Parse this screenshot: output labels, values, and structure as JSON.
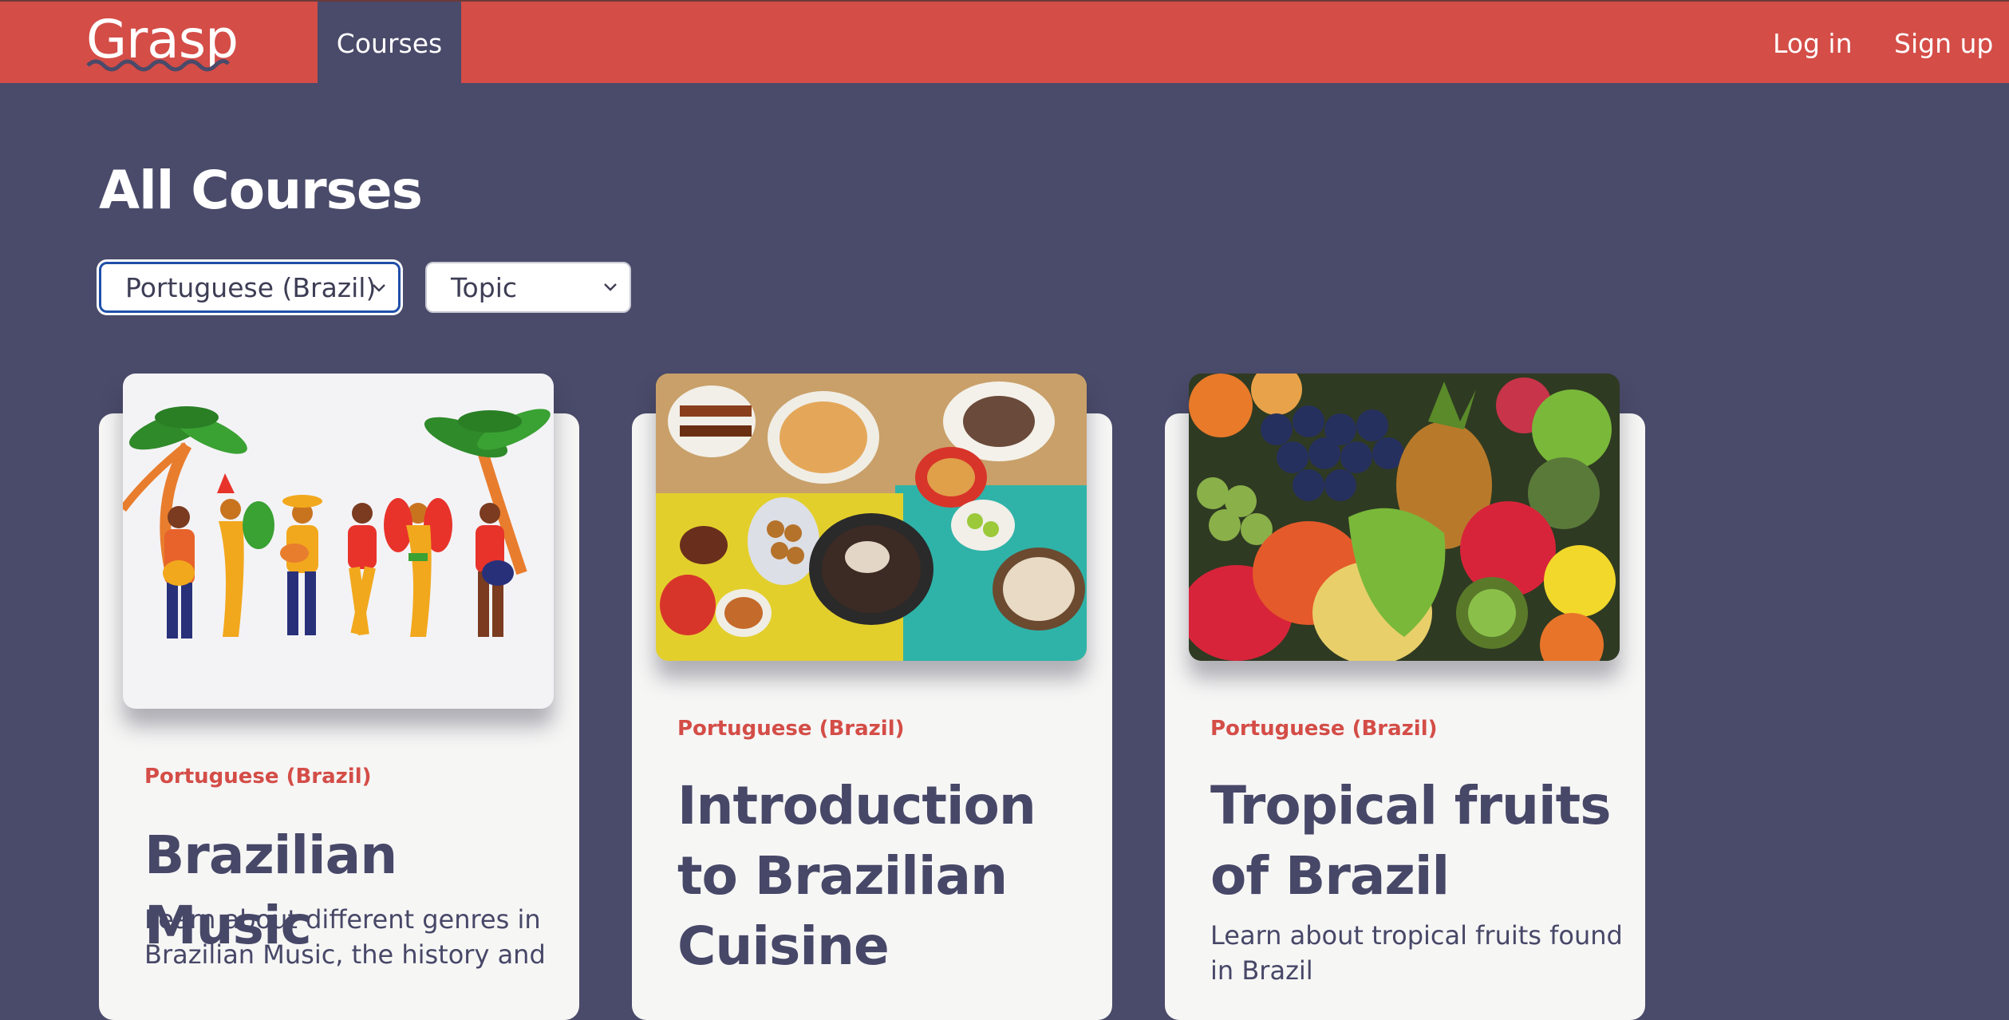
{
  "header": {
    "logo": "Grasp",
    "nav_courses": "Courses",
    "login": "Log in",
    "signup": "Sign up"
  },
  "main": {
    "title": "All Courses",
    "filters": {
      "language": "Portuguese (Brazil)",
      "topic": "Topic"
    },
    "cards": [
      {
        "tag": "Portuguese (Brazil)",
        "title": "Brazilian Music",
        "description": "Learn about different genres in Brazilian Music, the history and",
        "image": "samba-musicians-illustration"
      },
      {
        "tag": "Portuguese (Brazil)",
        "title": "Introduction to Brazilian Cuisine",
        "description": "",
        "image": "brazilian-food-table-photo"
      },
      {
        "tag": "Portuguese (Brazil)",
        "title": "Tropical fruits of Brazil",
        "description": "Learn about tropical fruits found in Brazil",
        "image": "tropical-fruits-photo"
      }
    ]
  },
  "colors": {
    "brand": "#d44d47",
    "background": "#4a4a6a",
    "card": "#f6f6f5",
    "text_dark": "#474768"
  }
}
